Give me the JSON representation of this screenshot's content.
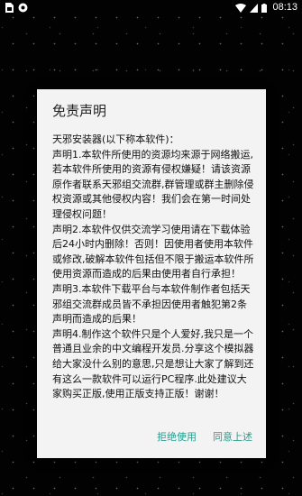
{
  "status_bar": {
    "time": "08:13",
    "icons": [
      "sim-icon",
      "wifi-icon",
      "cell-signal-icon",
      "battery-icon"
    ]
  },
  "dialog": {
    "title": "免责声明",
    "body": "天邪安装器(以下称本软件)：\n声明1.本软件所使用的资源均来源于网络搬运,若本软件所使用的资源有侵权嫌疑！请该资源原作者联系天邪组交流群,群管理或群主删除侵权资源或其他侵权内容！我们会在第一时间处理侵权问题！\n声明2.本软件仅供交流学习使用请在下载体验后24小时内删除！否则！因使用者使用本软件或修改,破解本软件包括但不限于搬运本软件所使用资源而造成的后果由使用者自行承担！\n声明3.本软件下载平台与本软件制作者包括天邪组交流群成员皆不承担因使用者触犯第2条声明而造成的后果！\n声明4.制作这个软件只是个人爱好,我只是一个普通且业余的中文编程开发员.分享这个模拟器给大家没什么别的意思,只是想让大家了解到还有这么一款软件可以运行PC程序.此处建议大家购买正版,使用正版支持正版！谢谢！",
    "decline_label": "拒绝使用",
    "accept_label": "同意上述"
  },
  "colors": {
    "accent": "#2a9d8f",
    "dialog_bg": "#f3f3f3",
    "screen_bg": "#030303"
  }
}
